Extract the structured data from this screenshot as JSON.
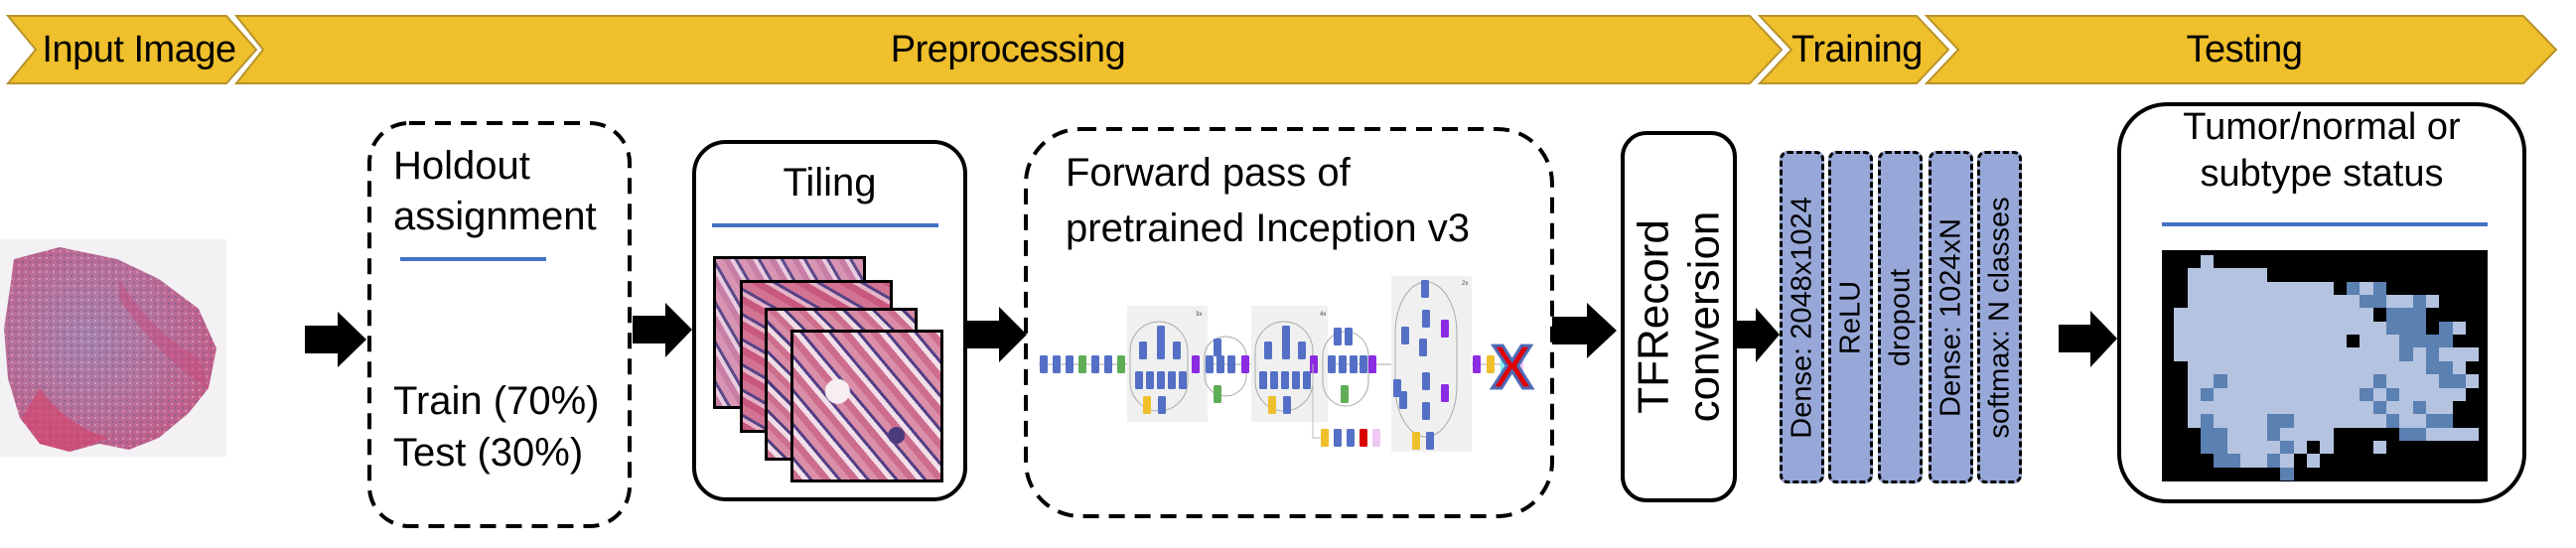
{
  "stages": [
    {
      "label": "Input Image"
    },
    {
      "label": "Preprocessing"
    },
    {
      "label": "Training"
    },
    {
      "label": "Testing"
    }
  ],
  "colors": {
    "banner_fill": "#efbf2c",
    "banner_stroke": "#b8932a",
    "rule": "#4472c4",
    "dense_fill": "#97a8d8",
    "heatmap_background": "#000000",
    "heatmap_class_1": "#b4c3df",
    "heatmap_class_2": "#5b80b2"
  },
  "input_image": {
    "description": "H&E whole slide image thumbnail"
  },
  "holdout": {
    "title_line1": "Holdout",
    "title_line2": "assignment",
    "train": "Train (70%)",
    "test": "Test (30%)"
  },
  "tiling": {
    "title": "Tiling",
    "tile_count": 4
  },
  "inception": {
    "title_line1": "Forward pass of",
    "title_line2": "pretrained Inception v3",
    "module_repeats": [
      "3x",
      "4x",
      "2x"
    ],
    "removed_mark": "X"
  },
  "tfrecord": {
    "line1": "TFRecord",
    "line2": "conversion"
  },
  "training_layers": [
    "Dense: 2048x1024",
    "ReLU",
    "dropout",
    "Dense: 1024xN",
    "softmax: N classes"
  ],
  "testing": {
    "title_line1": "Tumor/normal or",
    "title_line2": "subtype status",
    "heatmap_grid": [
      "...1.....................",
      "..111111.................",
      "..11111111111.212........",
      "..1111111111111221121....",
      ".111111111111111.222.....",
      ".1111111111111111222.21..",
      ".1111111111111.1112222...",
      ".11111111111111111212111.",
      "..111111111111111111221..",
      "..1121111111111121111221.",
      "..121111111111121211111..",
      "..11111111111111211211...",
      "..12111122111111121122...",
      "...2211121111.....221111.",
      "...22111121.1...1........",
      "....221121.1.............",
      ".........2..............."
    ]
  }
}
